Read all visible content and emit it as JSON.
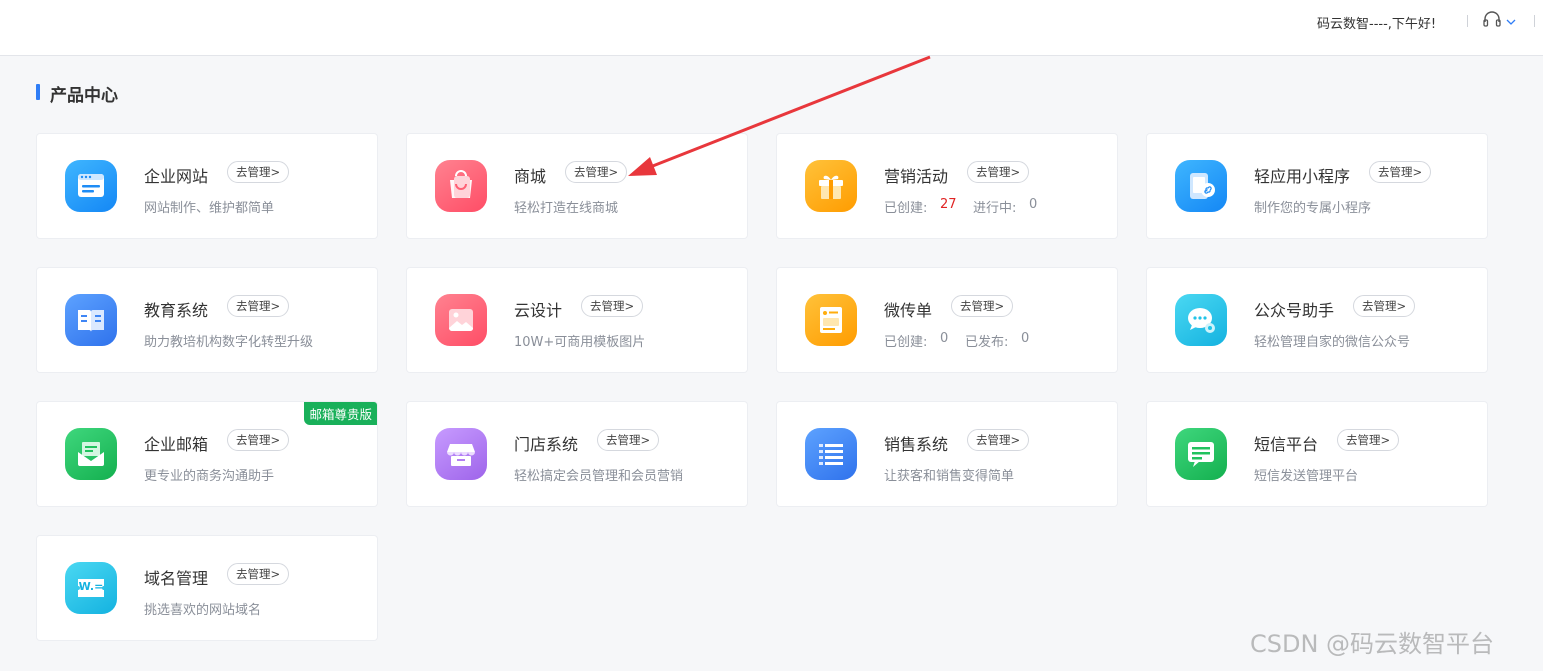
{
  "header": {
    "greeting": "码云数智----,下午好!",
    "support_icon": "headset-icon",
    "caret_icon": "chevron-down-icon"
  },
  "section": {
    "title": "产品中心"
  },
  "products": {
    "manage_label": "去管理>",
    "website": {
      "name": "企业网站",
      "desc": "网站制作、维护都简单",
      "icon": "website-window-icon",
      "color": "#1e9cff"
    },
    "mall": {
      "name": "商城",
      "desc": "轻松打造在线商城",
      "icon": "shopping-bag-icon",
      "color": "#ff5f74"
    },
    "marketing": {
      "name": "营销活动",
      "created_label": "已创建:",
      "created_value": "27",
      "running_label": "进行中:",
      "running_value": "0",
      "icon": "gift-icon",
      "color": "#ffad0e"
    },
    "miniapp": {
      "name": "轻应用小程序",
      "desc": "制作您的专属小程序",
      "icon": "phone-link-icon",
      "color": "#1e9cff"
    },
    "education": {
      "name": "教育系统",
      "desc": "助力教培机构数字化转型升级",
      "icon": "book-icon",
      "color": "#3f86f5"
    },
    "design": {
      "name": "云设计",
      "desc": "10W+可商用模板图片",
      "icon": "picture-icon",
      "color": "#ff5f74"
    },
    "flyer": {
      "name": "微传单",
      "created_label": "已创建:",
      "created_value": "0",
      "published_label": "已发布:",
      "published_value": "0",
      "icon": "flyer-icon",
      "color": "#ffad0e"
    },
    "wechat": {
      "name": "公众号助手",
      "desc": "轻松管理自家的微信公众号",
      "icon": "wechat-gear-icon",
      "color": "#21c4e8"
    },
    "email": {
      "name": "企业邮箱",
      "desc": "更专业的商务沟通助手",
      "badge": "邮箱尊贵版",
      "icon": "envelope-icon",
      "color": "#21c25e"
    },
    "store": {
      "name": "门店系统",
      "desc": "轻松搞定会员管理和会员营销",
      "icon": "storefront-icon",
      "color": "#b37ef2"
    },
    "sales": {
      "name": "销售系统",
      "desc": "让获客和销售变得简单",
      "icon": "list-icon",
      "color": "#3f86f5"
    },
    "sms": {
      "name": "短信平台",
      "desc": "短信发送管理平台",
      "icon": "message-icon",
      "color": "#21c25e"
    },
    "domain": {
      "name": "域名管理",
      "desc": "挑选喜欢的网站域名",
      "icon_text": "W.=",
      "icon": "domain-www-icon",
      "color": "#21c4e8"
    }
  },
  "watermark": "CSDN @码云数智平台"
}
